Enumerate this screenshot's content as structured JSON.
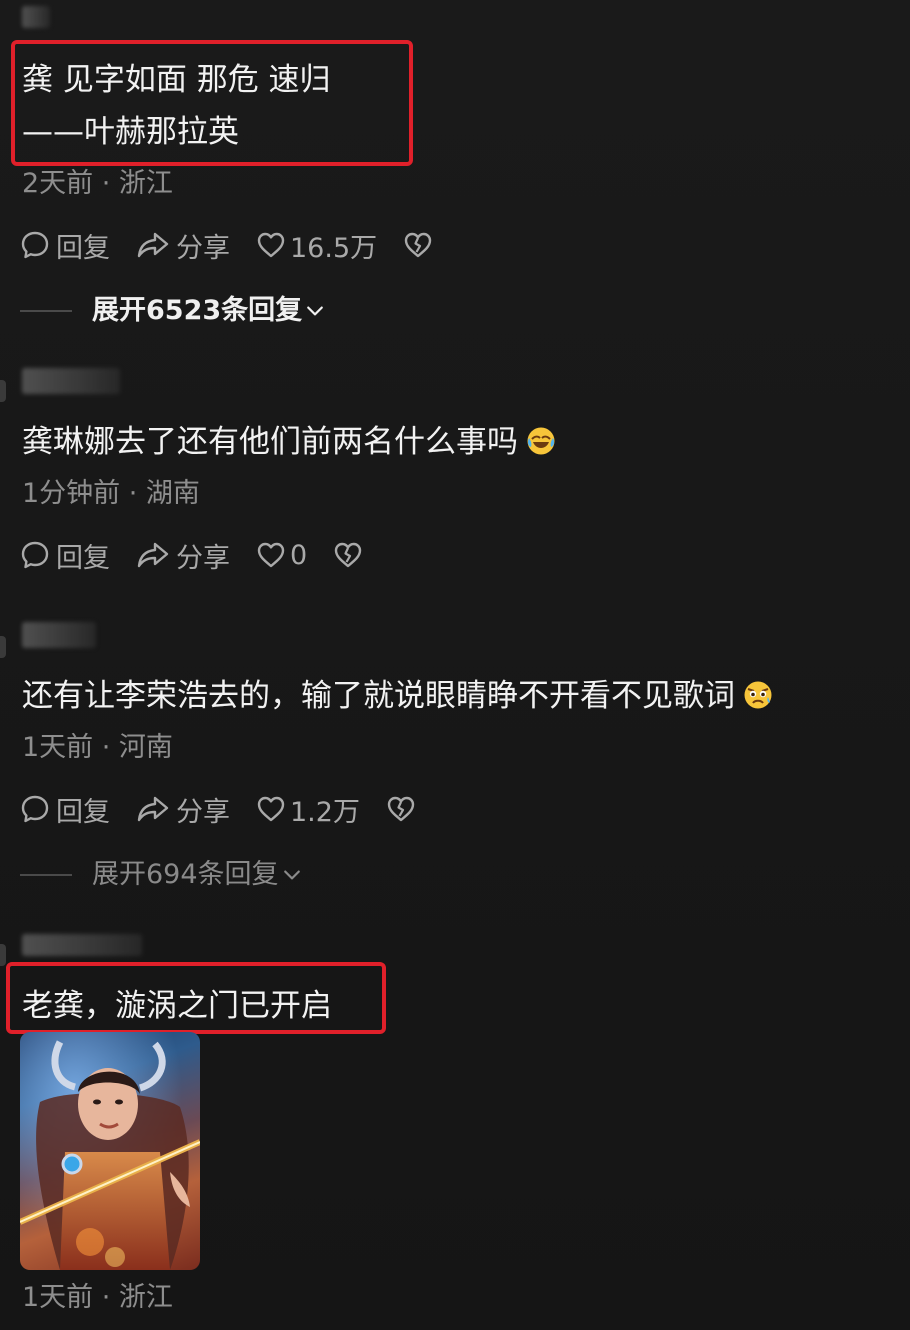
{
  "comments": [
    {
      "text_lines": [
        "龚 见字如面 那危 速归",
        "——叶赫那拉英"
      ],
      "meta": "2天前 · 浙江",
      "reply_label": "回复",
      "share_label": "分享",
      "likes": "16.5万",
      "expand_label": "展开6523条回复"
    },
    {
      "text": "龚琳娜去了还有他们前两名什么事吗",
      "emoji": "rofl-emoji",
      "meta": "1分钟前 · 湖南",
      "reply_label": "回复",
      "share_label": "分享",
      "likes": "0"
    },
    {
      "text": "还有让李荣浩去的，输了就说眼睛睁不开看不见歌词",
      "emoji": "anxious-emoji",
      "meta": "1天前 · 河南",
      "reply_label": "回复",
      "share_label": "分享",
      "likes": "1.2万",
      "expand_label": "展开694条回复"
    },
    {
      "text": "老龚，漩涡之门已开启",
      "image": "game-character-meme-image",
      "meta": "1天前 · 浙江"
    }
  ],
  "colors": {
    "background": "#161616",
    "highlight_box": "#e0202a",
    "meta_text": "#8e8e8e",
    "body_text": "#f2f2f2"
  }
}
